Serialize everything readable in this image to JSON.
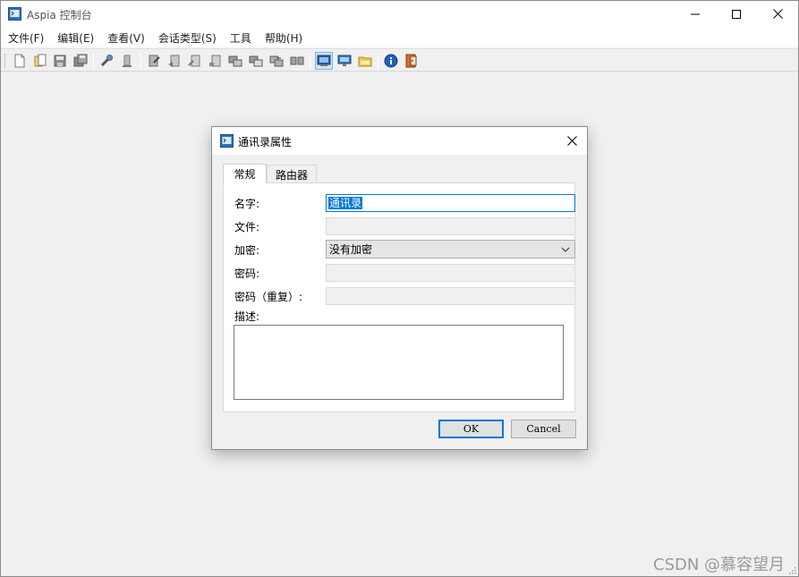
{
  "app": {
    "title": "Aspia 控制台",
    "icon": "aspia-console-icon"
  },
  "menu": [
    "文件(F)",
    "编辑(E)",
    "查看(V)",
    "会话类型(S)",
    "工具",
    "帮助(H)"
  ],
  "toolbar": {
    "buttons": [
      {
        "icon": "new-file-icon"
      },
      {
        "icon": "open-file-icon"
      },
      {
        "icon": "save-icon"
      },
      {
        "icon": "save-all-icon"
      },
      {
        "icon": "add-computer-icon"
      },
      {
        "icon": "delete-icon"
      },
      {
        "icon": "edit-icon"
      },
      {
        "icon": "computer-properties-icon"
      },
      {
        "icon": "copy-computer-icon"
      },
      {
        "icon": "modify-icon"
      },
      {
        "icon": "desktop-manage-icon"
      },
      {
        "icon": "desktop-view-icon"
      },
      {
        "icon": "file-transfer-icon"
      },
      {
        "icon": "system-info-icon"
      },
      {
        "icon": "session-manage-icon"
      },
      {
        "icon": "session-desktop-icon"
      },
      {
        "icon": "folder-icon"
      },
      {
        "icon": "info-icon"
      },
      {
        "icon": "exit-icon"
      }
    ],
    "active_button": "session-manage-icon"
  },
  "dialog": {
    "title": "通讯录属性",
    "tabs": [
      "常规",
      "路由器"
    ],
    "active_tab": "常规",
    "labels": {
      "name": "名字:",
      "file": "文件:",
      "encryption": "加密:",
      "password": "密码:",
      "password_repeat": "密码（重复）:",
      "description": "描述:"
    },
    "fields": {
      "name_value": "通讯录",
      "file_value": "",
      "encryption_value": "没有加密",
      "password_value": "",
      "password_repeat_value": "",
      "description_value": ""
    },
    "buttons": {
      "ok": "OK",
      "cancel": "Cancel"
    }
  },
  "watermark": "CSDN @慕容望月",
  "colors": {
    "accent": "#0078d7",
    "window_bg": "#f0f0f0",
    "panel_bg": "#ffffff"
  }
}
